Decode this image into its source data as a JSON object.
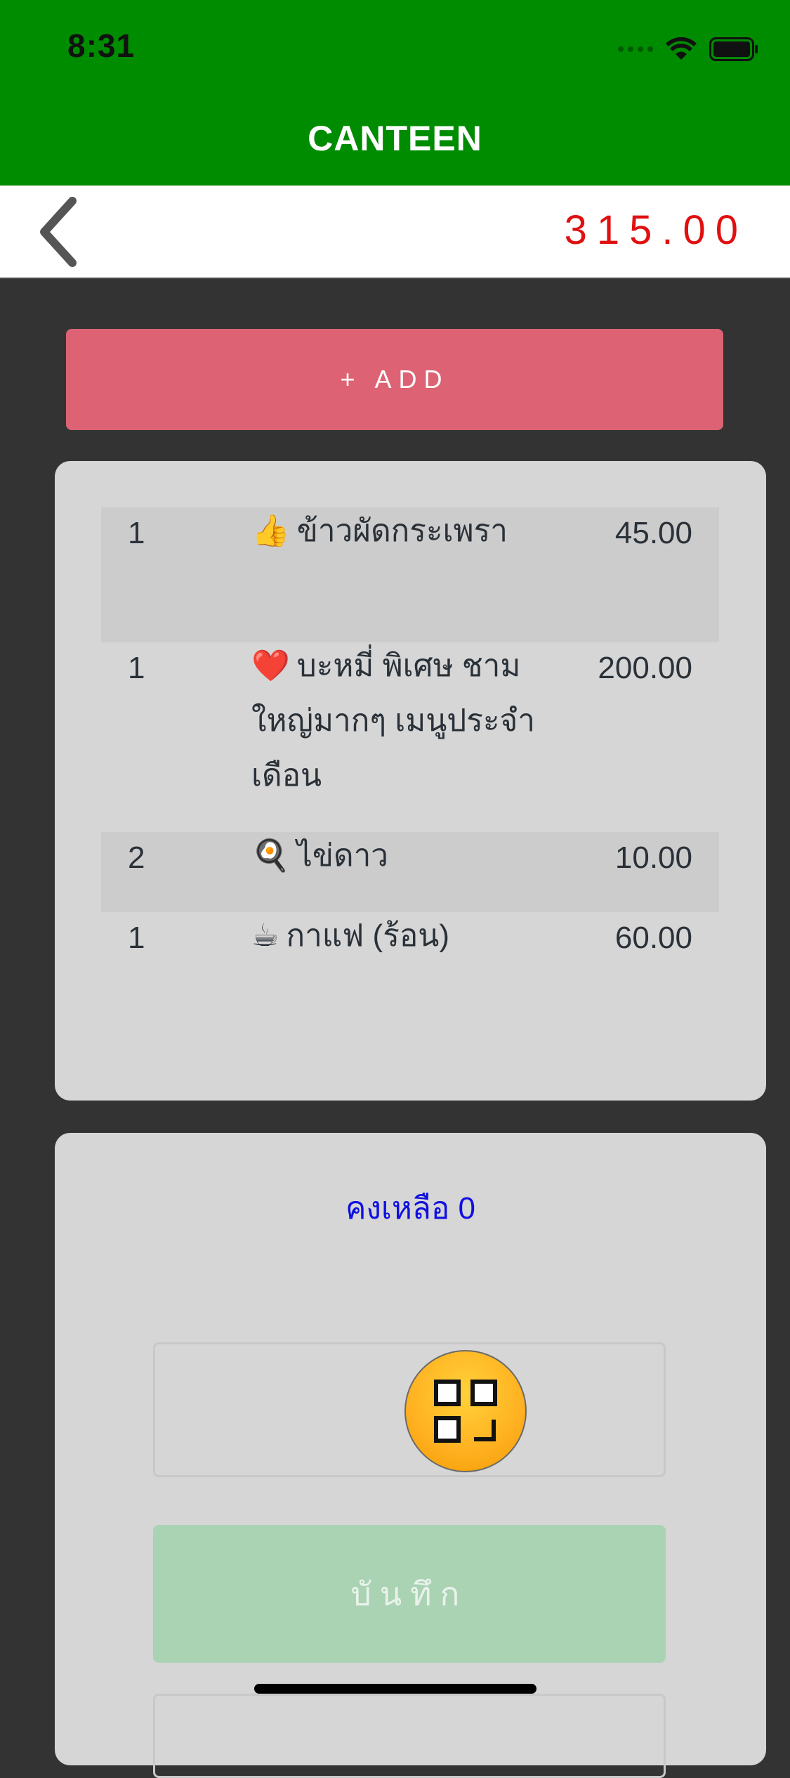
{
  "status_bar": {
    "time": "8:31"
  },
  "header": {
    "title": "CANTEEN"
  },
  "nav": {
    "total": "315.00"
  },
  "actions": {
    "add_label": "+ ADD"
  },
  "orders": [
    {
      "qty": "1",
      "icon": "thumbs-up-icon",
      "emoji": "👍",
      "name": "ข้าวผัดกระเพรา",
      "price": "45.00"
    },
    {
      "qty": "1",
      "icon": "heart-icon",
      "emoji": "❤️",
      "name": "บะหมี่ พิเศษ ชามใหญ่มากๆ เมนูประจำเดือน",
      "price": "200.00"
    },
    {
      "qty": "2",
      "icon": "fried-egg-icon",
      "emoji": "🍳",
      "name": "ไข่ดาว",
      "price": "10.00"
    },
    {
      "qty": "1",
      "icon": "coffee-icon",
      "emoji": "☕",
      "name": "กาแฟ (ร้อน)",
      "price": "60.00"
    }
  ],
  "payment": {
    "balance": "คงเหลือ 0",
    "save_label": "บันทึก"
  },
  "colors": {
    "header_green": "#008c00",
    "total_red": "#e01010",
    "add_pink": "#dd6374",
    "balance_blue": "#1010e0",
    "save_green": "#aad3b4"
  }
}
